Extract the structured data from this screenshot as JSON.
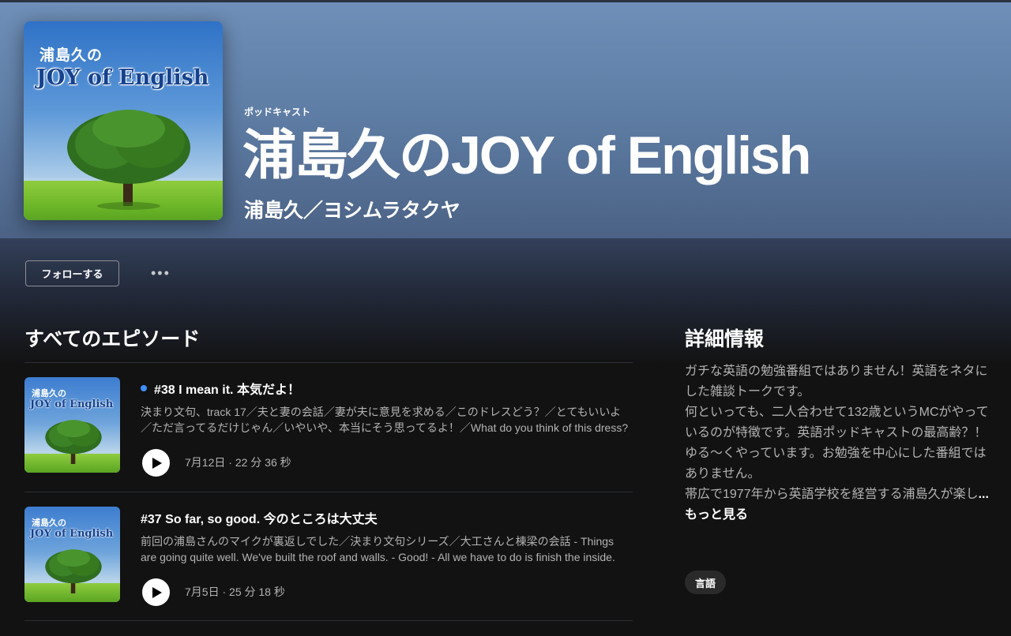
{
  "header": {
    "cover": {
      "subtitle": "浦島久の",
      "main": "JOY of English"
    },
    "kind": "ポッドキャスト",
    "title": "浦島久のJOY of English",
    "author": "浦島久／ヨシムラタクヤ"
  },
  "actions": {
    "follow_label": "フォローする",
    "more_label": "•••"
  },
  "episodes_section": {
    "title": "すべてのエピソード",
    "items": [
      {
        "title": "#38 I mean it. 本気だよ！",
        "unplayed": true,
        "description": "決まり文句、track 17／夫と妻の会話／妻が夫に意見を求める／このドレスどう？／とてもいいよ／ただ言ってるだけじゃん／いやいや、本当にそう思ってるよ！／What do you think of this dress?",
        "date": "7月12日",
        "duration": "22 分 36 秒",
        "thumb_sub": "浦島久の",
        "thumb_main": "JOY of English"
      },
      {
        "title": "#37 So far, so good. 今のところは大丈夫",
        "unplayed": false,
        "description": "前回の浦島さんのマイクが裏返しでした／決まり文句シリーズ／大工さんと棟梁の会話 - Things are going quite well. We've built the roof and walls. - Good! - All we have to do is finish the inside.",
        "date": "7月5日",
        "duration": "25 分 18 秒",
        "thumb_sub": "浦島久の",
        "thumb_main": "JOY of English"
      }
    ]
  },
  "details": {
    "title": "詳細情報",
    "lines": [
      "ガチな英語の勉強番組ではありません！英語をネタにした雑談トークです。",
      "何といっても、二人合わせて132歳というMCがやっているのが特徴です。英語ポッドキャストの最高齢？！",
      "ゆる〜くやっています。お勉強を中心にした番組ではありません。",
      "帯広で1977年から英語学校を経営する浦島久が楽し"
    ],
    "see_more": "... もっと見る",
    "tag": "言語"
  }
}
